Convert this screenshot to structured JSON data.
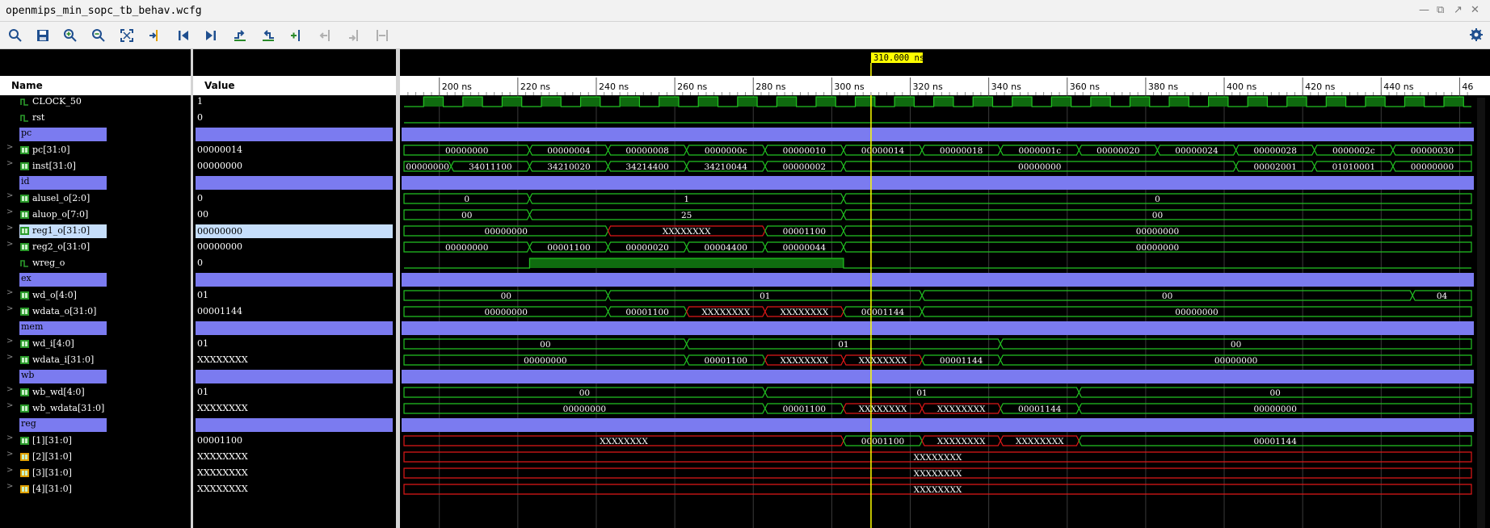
{
  "window": {
    "title": "openmips_min_sopc_tb_behav.wcfg"
  },
  "toolbar": {
    "icons": [
      "search-icon",
      "save-icon",
      "zoom-in-icon",
      "zoom-out-icon",
      "zoom-fit-icon",
      "go-to-cursor-icon",
      "go-to-time-0-icon",
      "go-to-last-time-icon",
      "previous-transition-icon",
      "next-transition-icon",
      "add-marker-icon",
      "previous-marker-icon",
      "next-marker-icon",
      "swap-cursors-icon",
      "settings-icon"
    ]
  },
  "headers": {
    "name": "Name",
    "value": "Value"
  },
  "cursor": {
    "label": "310.000 ns",
    "time": 310
  },
  "timeline": {
    "start": 191,
    "end": 463,
    "ticks": [
      "200 ns",
      "220 ns",
      "240 ns",
      "260 ns",
      "280 ns",
      "300 ns",
      "320 ns",
      "340 ns",
      "360 ns",
      "380 ns",
      "400 ns",
      "420 ns",
      "440 ns",
      "46"
    ]
  },
  "rows": [
    {
      "name": "CLOCK_50",
      "value": "1",
      "kind": "clk"
    },
    {
      "name": "rst",
      "value": "0",
      "kind": "low"
    },
    {
      "name": "pc",
      "value": "",
      "kind": "div"
    },
    {
      "name": "pc[31:0]",
      "value": "00000014",
      "kind": "bus",
      "segs": [
        [
          191,
          223,
          "00000000"
        ],
        [
          223,
          243,
          "00000004"
        ],
        [
          243,
          263,
          "00000008"
        ],
        [
          263,
          283,
          "0000000c"
        ],
        [
          283,
          303,
          "00000010"
        ],
        [
          303,
          323,
          "00000014"
        ],
        [
          323,
          343,
          "00000018"
        ],
        [
          343,
          363,
          "0000001c"
        ],
        [
          363,
          383,
          "00000020"
        ],
        [
          383,
          403,
          "00000024"
        ],
        [
          403,
          423,
          "00000028"
        ],
        [
          423,
          443,
          "0000002c"
        ],
        [
          443,
          463,
          "00000030"
        ]
      ]
    },
    {
      "name": "inst[31:0]",
      "value": "00000000",
      "kind": "bus",
      "segs": [
        [
          191,
          203,
          "00000000"
        ],
        [
          203,
          223,
          "34011100"
        ],
        [
          223,
          243,
          "34210020"
        ],
        [
          243,
          263,
          "34214400"
        ],
        [
          263,
          283,
          "34210044"
        ],
        [
          283,
          303,
          "00000002"
        ],
        [
          303,
          403,
          "00000000"
        ],
        [
          403,
          423,
          "00002001"
        ],
        [
          423,
          443,
          "01010001"
        ],
        [
          443,
          463,
          "00000000"
        ]
      ]
    },
    {
      "name": "id",
      "value": "",
      "kind": "div"
    },
    {
      "name": "alusel_o[2:0]",
      "value": "0",
      "kind": "bus",
      "segs": [
        [
          191,
          223,
          "0"
        ],
        [
          223,
          303,
          "1"
        ],
        [
          303,
          463,
          "0"
        ]
      ]
    },
    {
      "name": "aluop_o[7:0]",
      "value": "00",
      "kind": "bus",
      "segs": [
        [
          191,
          223,
          "00"
        ],
        [
          223,
          303,
          "25"
        ],
        [
          303,
          463,
          "00"
        ]
      ]
    },
    {
      "name": "reg1_o[31:0]",
      "value": "00000000",
      "kind": "bus",
      "sel": true,
      "segs": [
        [
          191,
          243,
          "00000000"
        ],
        [
          243,
          283,
          "XXXXXXXX",
          "x"
        ],
        [
          283,
          303,
          "00001100"
        ],
        [
          303,
          463,
          "00000000"
        ]
      ]
    },
    {
      "name": "reg2_o[31:0]",
      "value": "00000000",
      "kind": "bus",
      "segs": [
        [
          191,
          223,
          "00000000"
        ],
        [
          223,
          243,
          "00001100"
        ],
        [
          243,
          263,
          "00000020"
        ],
        [
          263,
          283,
          "00004400"
        ],
        [
          283,
          303,
          "00000044"
        ],
        [
          303,
          463,
          "00000000"
        ]
      ]
    },
    {
      "name": "wreg_o",
      "value": "0",
      "kind": "bit",
      "high": [
        [
          223,
          303
        ]
      ]
    },
    {
      "name": "ex",
      "value": "",
      "kind": "div"
    },
    {
      "name": "wd_o[4:0]",
      "value": "01",
      "kind": "bus",
      "segs": [
        [
          191,
          243,
          "00"
        ],
        [
          243,
          323,
          "01"
        ],
        [
          323,
          448,
          "00"
        ],
        [
          448,
          463,
          "04"
        ]
      ]
    },
    {
      "name": "wdata_o[31:0]",
      "value": "00001144",
      "kind": "bus",
      "segs": [
        [
          191,
          243,
          "00000000"
        ],
        [
          243,
          263,
          "00001100"
        ],
        [
          263,
          283,
          "XXXXXXXX",
          "x"
        ],
        [
          283,
          303,
          "XXXXXXXX",
          "x"
        ],
        [
          303,
          323,
          "00001144"
        ],
        [
          323,
          463,
          "00000000"
        ]
      ]
    },
    {
      "name": "mem",
      "value": "",
      "kind": "div"
    },
    {
      "name": "wd_i[4:0]",
      "value": "01",
      "kind": "bus",
      "segs": [
        [
          191,
          263,
          "00"
        ],
        [
          263,
          343,
          "01"
        ],
        [
          343,
          463,
          "00"
        ]
      ]
    },
    {
      "name": "wdata_i[31:0]",
      "value": "XXXXXXXX",
      "kind": "bus",
      "segs": [
        [
          191,
          263,
          "00000000"
        ],
        [
          263,
          283,
          "00001100"
        ],
        [
          283,
          303,
          "XXXXXXXX",
          "x"
        ],
        [
          303,
          323,
          "XXXXXXXX",
          "x"
        ],
        [
          323,
          343,
          "00001144"
        ],
        [
          343,
          463,
          "00000000"
        ]
      ]
    },
    {
      "name": "wb",
      "value": "",
      "kind": "div"
    },
    {
      "name": "wb_wd[4:0]",
      "value": "01",
      "kind": "bus",
      "segs": [
        [
          191,
          283,
          "00"
        ],
        [
          283,
          363,
          "01"
        ],
        [
          363,
          463,
          "00"
        ]
      ]
    },
    {
      "name": "wb_wdata[31:0]",
      "value": "XXXXXXXX",
      "kind": "bus",
      "segs": [
        [
          191,
          283,
          "00000000"
        ],
        [
          283,
          303,
          "00001100"
        ],
        [
          303,
          323,
          "XXXXXXXX",
          "x"
        ],
        [
          323,
          343,
          "XXXXXXXX",
          "x"
        ],
        [
          343,
          363,
          "00001144"
        ],
        [
          363,
          463,
          "00000000"
        ]
      ]
    },
    {
      "name": "reg",
      "value": "",
      "kind": "div"
    },
    {
      "name": "[1][31:0]",
      "value": "00001100",
      "kind": "bus",
      "segs": [
        [
          191,
          303,
          "XXXXXXXX",
          "x"
        ],
        [
          303,
          323,
          "00001100"
        ],
        [
          323,
          343,
          "XXXXXXXX",
          "x"
        ],
        [
          343,
          363,
          "XXXXXXXX",
          "x"
        ],
        [
          363,
          463,
          "00001144"
        ]
      ]
    },
    {
      "name": "[2][31:0]",
      "value": "XXXXXXXX",
      "kind": "bus",
      "segs": [
        [
          191,
          463,
          "XXXXXXXX",
          "x"
        ]
      ]
    },
    {
      "name": "[3][31:0]",
      "value": "XXXXXXXX",
      "kind": "bus",
      "segs": [
        [
          191,
          463,
          "XXXXXXXX",
          "x"
        ]
      ]
    },
    {
      "name": "[4][31:0]",
      "value": "XXXXXXXX",
      "kind": "bus",
      "segs": [
        [
          191,
          463,
          "XXXXXXXX",
          "x"
        ]
      ]
    }
  ],
  "colors": {
    "accent": "#22c222",
    "undefined": "#e01818",
    "divider": "#7b7bf0",
    "cursor": "#ffff00",
    "selection": "#c6defb"
  }
}
